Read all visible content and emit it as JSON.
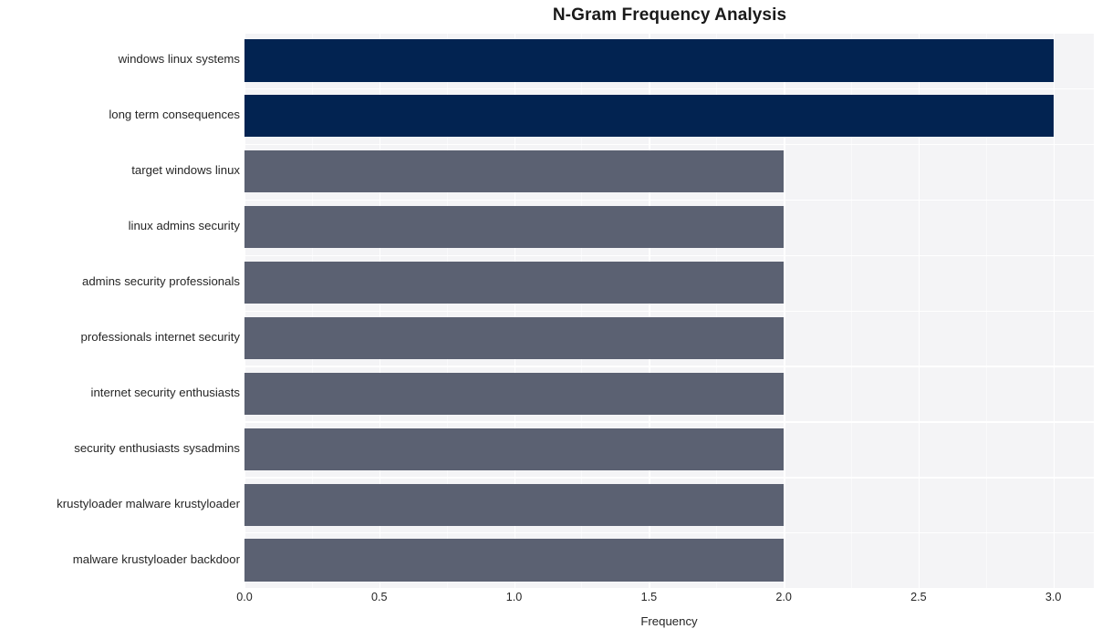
{
  "chart_data": {
    "type": "bar",
    "orientation": "horizontal",
    "title": "N-Gram Frequency Analysis",
    "xlabel": "Frequency",
    "ylabel": "",
    "categories": [
      "windows linux systems",
      "long term consequences",
      "target windows linux",
      "linux admins security",
      "admins security professionals",
      "professionals internet security",
      "internet security enthusiasts",
      "security enthusiasts sysadmins",
      "krustyloader malware krustyloader",
      "malware krustyloader backdoor"
    ],
    "values": [
      3,
      3,
      2,
      2,
      2,
      2,
      2,
      2,
      2,
      2
    ],
    "bar_colors": [
      "#022351",
      "#022351",
      "#5b6172",
      "#5b6172",
      "#5b6172",
      "#5b6172",
      "#5b6172",
      "#5b6172",
      "#5b6172",
      "#5b6172"
    ],
    "xlim": [
      0.0,
      3.15
    ],
    "xticks": [
      "0.0",
      "0.5",
      "1.0",
      "1.5",
      "2.0",
      "2.5",
      "3.0"
    ],
    "xtick_values": [
      0.0,
      0.5,
      1.0,
      1.5,
      2.0,
      2.5,
      3.0
    ],
    "grid": true,
    "grid_color": "#ffffff",
    "plot_background": "#f4f4f6",
    "figure_background": "#ffffff",
    "legend": null
  }
}
